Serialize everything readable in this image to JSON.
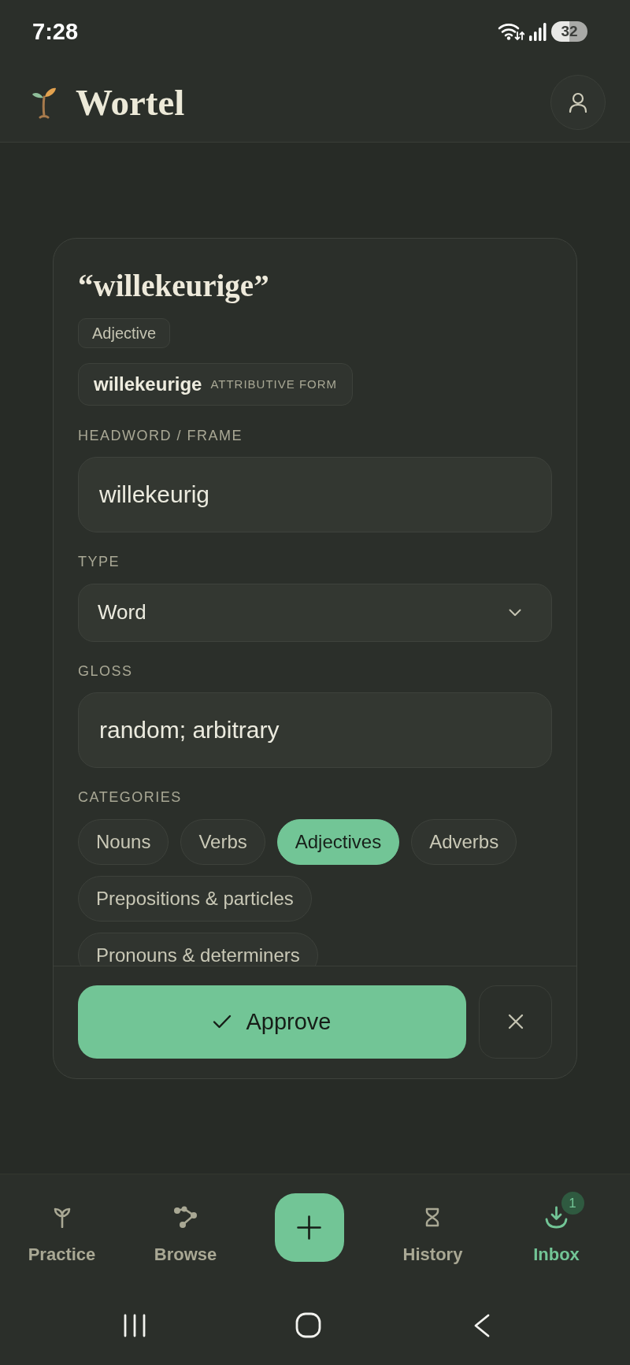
{
  "status_bar": {
    "time": "7:28",
    "battery": "32"
  },
  "header": {
    "title": "Wortel"
  },
  "card": {
    "title": "“willekeurige”",
    "tag": "Adjective",
    "form": {
      "word": "willekeurige",
      "label": "ATTRIBUTIVE FORM"
    },
    "fields": [
      {
        "kind": "text",
        "label": "HEADWORD / FRAME",
        "value": "willekeurig"
      },
      {
        "kind": "select",
        "label": "TYPE",
        "value": "Word"
      },
      {
        "kind": "text",
        "label": "GLOSS",
        "value": "random; arbitrary"
      }
    ],
    "categories": {
      "label": "CATEGORIES",
      "items": [
        {
          "label": "Nouns",
          "selected": false
        },
        {
          "label": "Verbs",
          "selected": false
        },
        {
          "label": "Adjectives",
          "selected": true
        },
        {
          "label": "Adverbs",
          "selected": false
        },
        {
          "label": "Prepositions & particles",
          "selected": false
        },
        {
          "label": "Pronouns & determiners",
          "selected": false
        }
      ]
    },
    "approve_button": "Approve"
  },
  "bottom_nav": {
    "items": [
      {
        "kind": "tab",
        "label": "Practice",
        "selected": false
      },
      {
        "kind": "tab",
        "label": "Browse",
        "selected": false
      },
      {
        "kind": "add"
      },
      {
        "kind": "tab",
        "label": "History",
        "selected": false
      },
      {
        "kind": "tab",
        "label": "Inbox",
        "selected": true,
        "badge": "1"
      }
    ]
  }
}
